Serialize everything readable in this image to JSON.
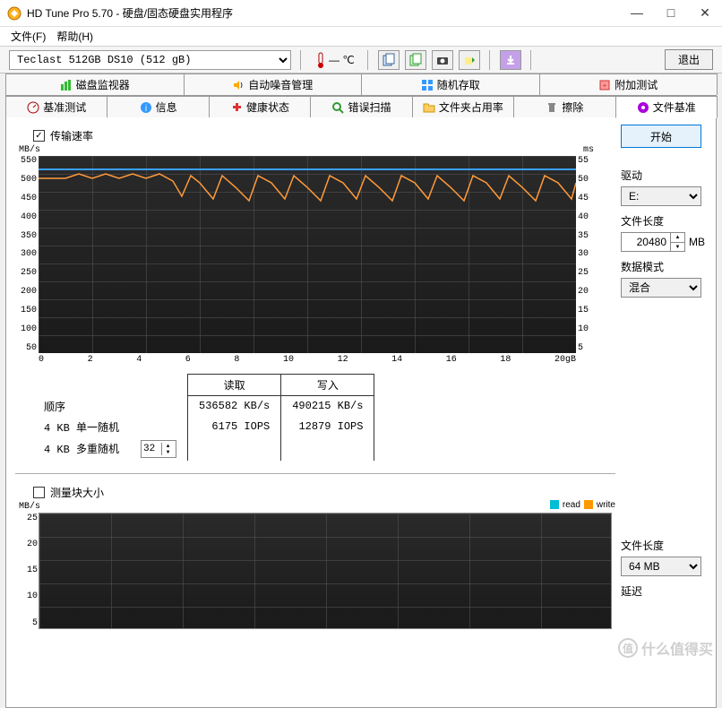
{
  "window": {
    "title": "HD Tune Pro 5.70 - 硬盘/固态硬盘实用程序"
  },
  "menubar": {
    "file": "文件(F)",
    "help": "帮助(H)"
  },
  "toolbar": {
    "drive_selected": "Teclast 512GB DS10 (512 gB)",
    "temp_value": "— ℃",
    "exit_label": "退出"
  },
  "tabs_row1": {
    "monitor": "磁盘监视器",
    "aam": "自动噪音管理",
    "random": "随机存取",
    "extra": "附加测试"
  },
  "tabs_row2": {
    "benchmark": "基准测试",
    "info": "信息",
    "health": "健康状态",
    "error": "错误扫描",
    "folder": "文件夹占用率",
    "erase": "擦除",
    "filebench": "文件基准"
  },
  "chart1": {
    "checkbox_label": "传输速率",
    "unit_left": "MB/s",
    "unit_right": "ms",
    "y_left": [
      "550",
      "500",
      "450",
      "400",
      "350",
      "300",
      "250",
      "200",
      "150",
      "100",
      "50"
    ],
    "y_right": [
      "55",
      "50",
      "45",
      "40",
      "35",
      "30",
      "25",
      "20",
      "15",
      "10",
      "5"
    ],
    "x": [
      "0",
      "2",
      "4",
      "6",
      "8",
      "10",
      "12",
      "14",
      "16",
      "18",
      "20gB"
    ]
  },
  "results": {
    "col_read": "读取",
    "col_write": "写入",
    "row_seq": "顺序",
    "row_4k_single": "4 KB 单一随机",
    "row_4k_multi": "4 KB 多重随机",
    "multi_queue": "32",
    "seq_read": "536582 KB/s",
    "seq_write": "490215 KB/s",
    "single_read": "6175 IOPS",
    "single_write": "12879 IOPS"
  },
  "chart2": {
    "checkbox_label": "测量块大小",
    "unit_left": "MB/s",
    "y_left": [
      "25",
      "20",
      "15",
      "10",
      "5"
    ],
    "legend_read": "read",
    "legend_write": "write"
  },
  "sidebar": {
    "start_label": "开始",
    "drive_label": "驱动",
    "drive_value": "E:",
    "filelen_label": "文件长度",
    "filelen_value": "20480",
    "filelen_unit": "MB",
    "datamode_label": "数据模式",
    "datamode_value": "混合",
    "filelen2_label": "文件长度",
    "filelen2_value": "64 MB",
    "delay_label": "延迟"
  },
  "chart_data": [
    {
      "type": "line",
      "title": "传输速率",
      "xlabel": "gB",
      "ylabel_left": "MB/s",
      "ylabel_right": "ms",
      "xlim": [
        0,
        20
      ],
      "ylim_left": [
        50,
        550
      ],
      "ylim_right": [
        5,
        55
      ],
      "x": [
        0,
        1,
        2,
        3,
        4,
        5,
        6,
        7,
        8,
        9,
        10,
        11,
        12,
        13,
        14,
        15,
        16,
        17,
        18,
        19,
        20
      ],
      "series": [
        {
          "name": "speed_blue_MBps",
          "color": "#3aa0ff",
          "values": [
            515,
            515,
            515,
            515,
            515,
            515,
            515,
            515,
            515,
            515,
            515,
            515,
            515,
            515,
            515,
            515,
            515,
            515,
            515,
            515,
            515
          ]
        },
        {
          "name": "speed_orange_MBps",
          "color": "#ff9a3a",
          "values": [
            490,
            490,
            490,
            490,
            490,
            480,
            470,
            475,
            480,
            475,
            470,
            475,
            470,
            480,
            470,
            475,
            470,
            480,
            475,
            470,
            465
          ]
        }
      ]
    },
    {
      "type": "line",
      "title": "测量块大小",
      "xlabel": "",
      "ylabel": "MB/s",
      "ylim": [
        5,
        25
      ],
      "series": [
        {
          "name": "read",
          "color": "#00bcd4",
          "values": []
        },
        {
          "name": "write",
          "color": "#ff9800",
          "values": []
        }
      ]
    }
  ],
  "watermark": "什么值得买"
}
